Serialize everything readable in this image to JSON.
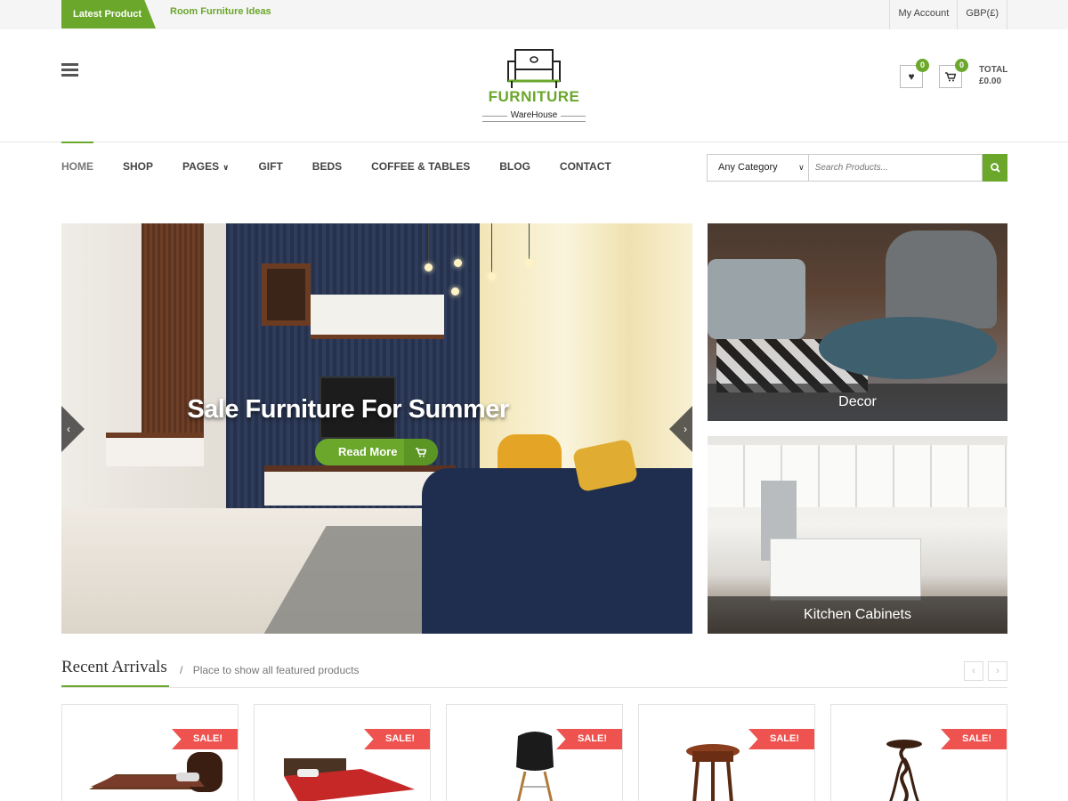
{
  "topbar": {
    "latest_label": "Latest Product",
    "ticker": "Room Furniture Ideas",
    "account": "My Account",
    "currency": "GBP(£)"
  },
  "logo": {
    "brand": "FURNITURE",
    "sub": "WareHouse"
  },
  "header": {
    "wishlist_count": "0",
    "cart_count": "0",
    "total_label": "TOTAL",
    "total_value": "£0.00"
  },
  "nav": {
    "items": [
      "HOME",
      "SHOP",
      "PAGES",
      "GIFT",
      "BEDS",
      "COFFEE & TABLES",
      "BLOG",
      "CONTACT"
    ]
  },
  "search": {
    "category": "Any Category",
    "placeholder": "Search Products..."
  },
  "hero": {
    "title": "Sale Furniture For Summer",
    "button": "Read More"
  },
  "banners": [
    {
      "label": "Decor"
    },
    {
      "label": "Kitchen Cabinets"
    }
  ],
  "recent": {
    "title": "Recent Arrivals",
    "separator": "/",
    "subtitle": "Place to show all featured products"
  },
  "products": [
    {
      "badge": "SALE!"
    },
    {
      "badge": "SALE!"
    },
    {
      "badge": "SALE!"
    },
    {
      "badge": "SALE!"
    },
    {
      "badge": "SALE!"
    }
  ],
  "colors": {
    "accent": "#6aa72b",
    "sale": "#ee5350"
  }
}
